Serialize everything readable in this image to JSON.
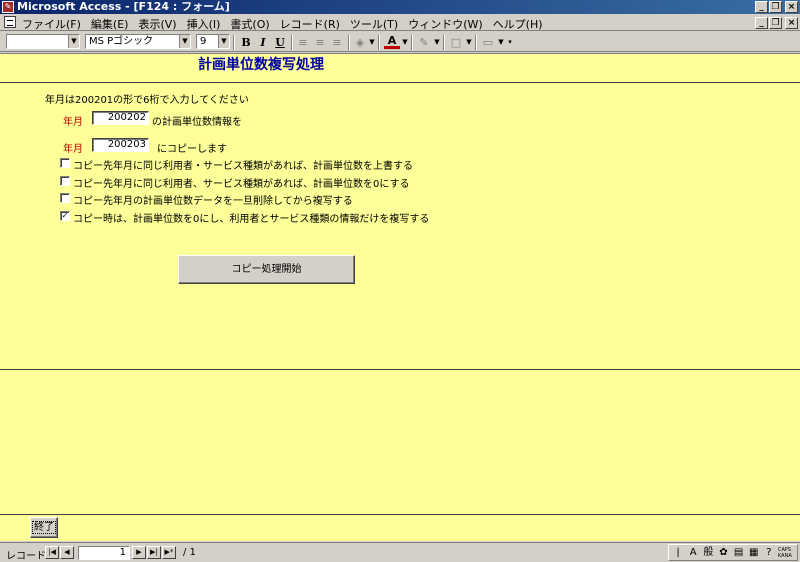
{
  "window": {
    "title": "Microsoft Access - [F124 : フォーム]",
    "app_icon": "access-key-icon",
    "minimize": "_",
    "restore": "❐",
    "close": "×"
  },
  "menu": {
    "items": [
      "ファイル(F)",
      "編集(E)",
      "表示(V)",
      "挿入(I)",
      "書式(O)",
      "レコード(R)",
      "ツール(T)",
      "ウィンドウ(W)",
      "ヘルプ(H)"
    ]
  },
  "toolbar": {
    "object_combo": "",
    "font_name": "MS Pゴシック",
    "font_size": "9",
    "bold": "B",
    "italic": "I",
    "underline": "U"
  },
  "form": {
    "title": "計画単位数複写処理",
    "instruction": "年月は200201の形で6桁で入力してください",
    "source_label": "年月",
    "source_value": "200202",
    "source_suffix": "の計画単位数情報を",
    "target_label": "年月",
    "target_value": "200203",
    "target_suffix": "にコピーします",
    "options": [
      {
        "label": "コピー先年月に同じ利用者・サービス種類があれば、計画単位数を上書する",
        "checked": false
      },
      {
        "label": "コピー先年月に同じ利用者、サービス種類があれば、計画単位数を0にする",
        "checked": false
      },
      {
        "label": "コピー先年月の計画単位数データを一旦削除してから複写する",
        "checked": false
      },
      {
        "label": "コピー時は、計画単位数を0にし、利用者とサービス種類の情報だけを複写する",
        "checked": true
      }
    ],
    "start_button": "コピー処理開始",
    "end_button": "終了"
  },
  "navigation": {
    "label": "レコード:",
    "current": "1",
    "total": "/ 1"
  },
  "ime": {
    "mode": "般",
    "caps": "CAPS KANA"
  },
  "colors": {
    "form_background": "#ffff99",
    "title_color": "#0000a0",
    "label_red": "#c00000",
    "titlebar_start": "#0a246a"
  }
}
